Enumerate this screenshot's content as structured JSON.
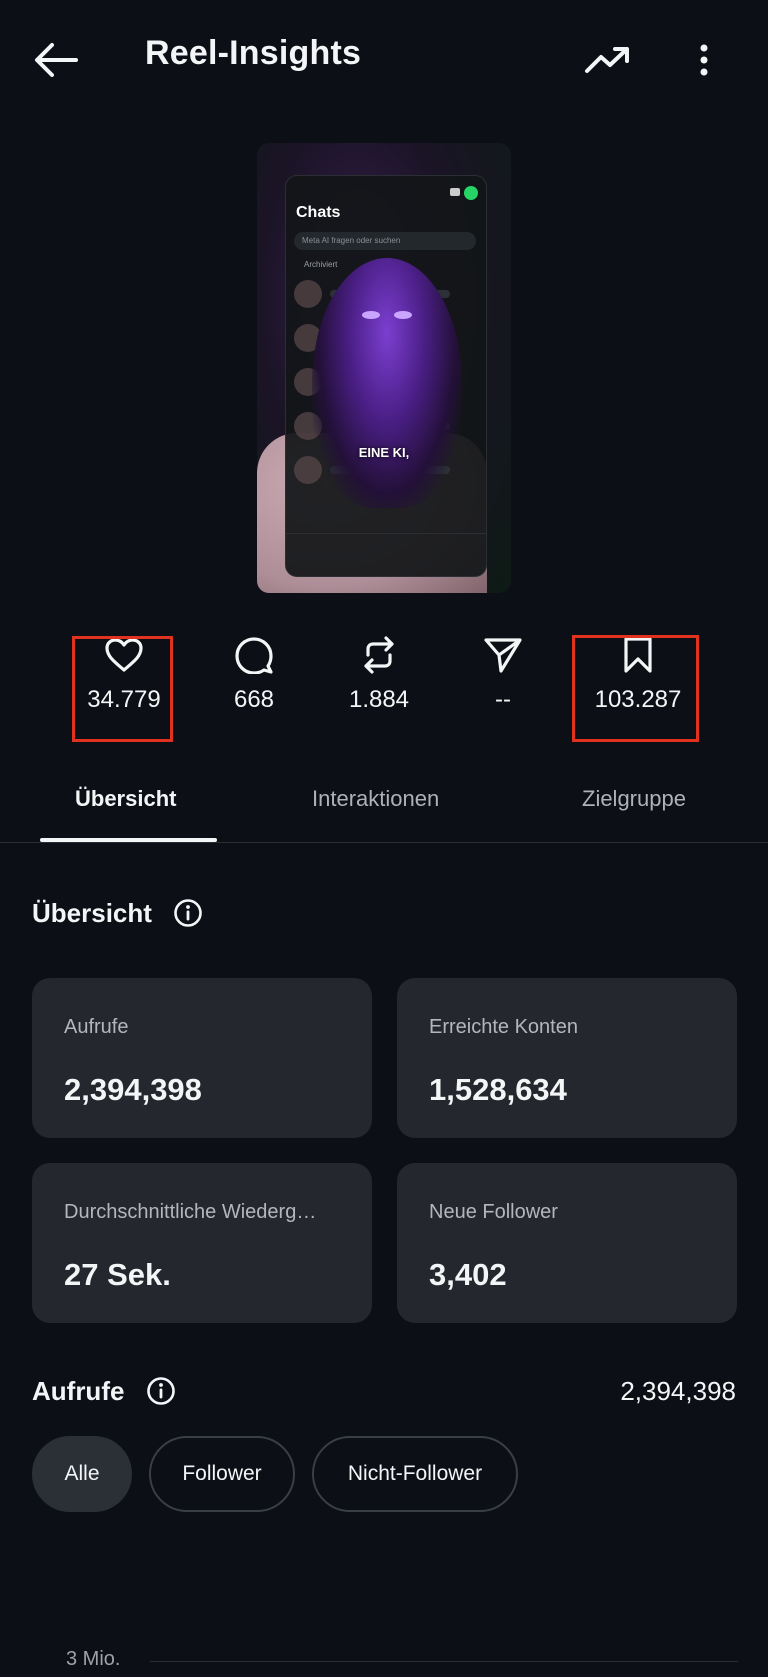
{
  "header": {
    "title": "Reel-Insights",
    "back_icon": "arrow-left-icon",
    "trend_icon": "trending-up-icon",
    "more_icon": "more-vertical-icon"
  },
  "thumbnail": {
    "phone_title": "Chats",
    "phone_search": "Meta AI fragen oder suchen",
    "phone_archived": "Archiviert",
    "caption": "EINE KI,"
  },
  "stats": [
    {
      "icon": "heart-icon",
      "value": "34.779"
    },
    {
      "icon": "comment-icon",
      "value": "668"
    },
    {
      "icon": "repost-icon",
      "value": "1.884"
    },
    {
      "icon": "share-icon",
      "value": "--"
    },
    {
      "icon": "bookmark-icon",
      "value": "103.287"
    }
  ],
  "tabs": [
    {
      "label": "Übersicht",
      "active": true
    },
    {
      "label": "Interaktionen",
      "active": false
    },
    {
      "label": "Zielgruppe",
      "active": false
    }
  ],
  "overview": {
    "title": "Übersicht",
    "cards": [
      {
        "label": "Aufrufe",
        "value": "2,394,398"
      },
      {
        "label": "Erreichte Konten",
        "value": "1,528,634"
      },
      {
        "label": "Durchschnittliche Wiederg…",
        "value": "27 Sek."
      },
      {
        "label": "Neue Follower",
        "value": "3,402"
      }
    ]
  },
  "views": {
    "title": "Aufrufe",
    "total": "2,394,398",
    "filters": [
      {
        "label": "Alle",
        "active": true
      },
      {
        "label": "Follower",
        "active": false
      },
      {
        "label": "Nicht-Follower",
        "active": false
      }
    ],
    "y_label": "3 Mio."
  },
  "colors": {
    "background": "#0c0f15",
    "card": "#24272d",
    "highlight": "#e0321f"
  }
}
